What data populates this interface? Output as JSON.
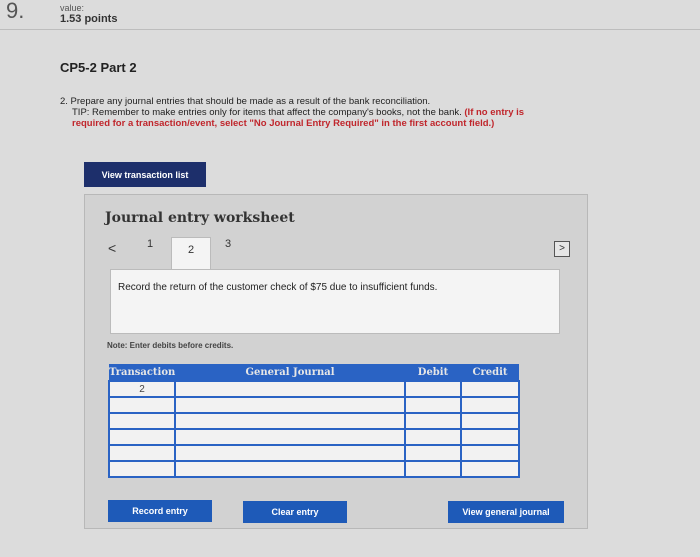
{
  "question": {
    "number": "9.",
    "value_label": "value:",
    "points": "1.53 points"
  },
  "part_title": "CP5-2 Part 2",
  "instructions": {
    "line1": "2. Prepare any journal entries that should be made as a result of the bank reconciliation.",
    "line2": "TIP: Remember to make entries only for items that affect the company's books, not the bank.",
    "note_red": "(If no entry is required for a transaction/event, select \"No Journal Entry Required\" in the first account field.)"
  },
  "buttons": {
    "view_transaction_list": "View transaction list",
    "record_entry": "Record entry",
    "clear_entry": "Clear entry",
    "view_general_journal": "View general journal"
  },
  "worksheet": {
    "title": "Journal entry worksheet",
    "prev": "<",
    "next": ">",
    "tabs": [
      "1",
      "2",
      "3"
    ],
    "active_tab": "2",
    "record_text": "Record the return of the customer check of $75 due to insufficient funds.",
    "note": "Note: Enter debits before credits."
  },
  "table": {
    "headers": [
      "Transaction",
      "General Journal",
      "Debit",
      "Credit"
    ],
    "rows": [
      [
        "2",
        "",
        "",
        ""
      ],
      [
        "",
        "",
        "",
        ""
      ],
      [
        "",
        "",
        "",
        ""
      ],
      [
        "",
        "",
        "",
        ""
      ],
      [
        "",
        "",
        "",
        ""
      ],
      [
        "",
        "",
        "",
        ""
      ]
    ]
  }
}
